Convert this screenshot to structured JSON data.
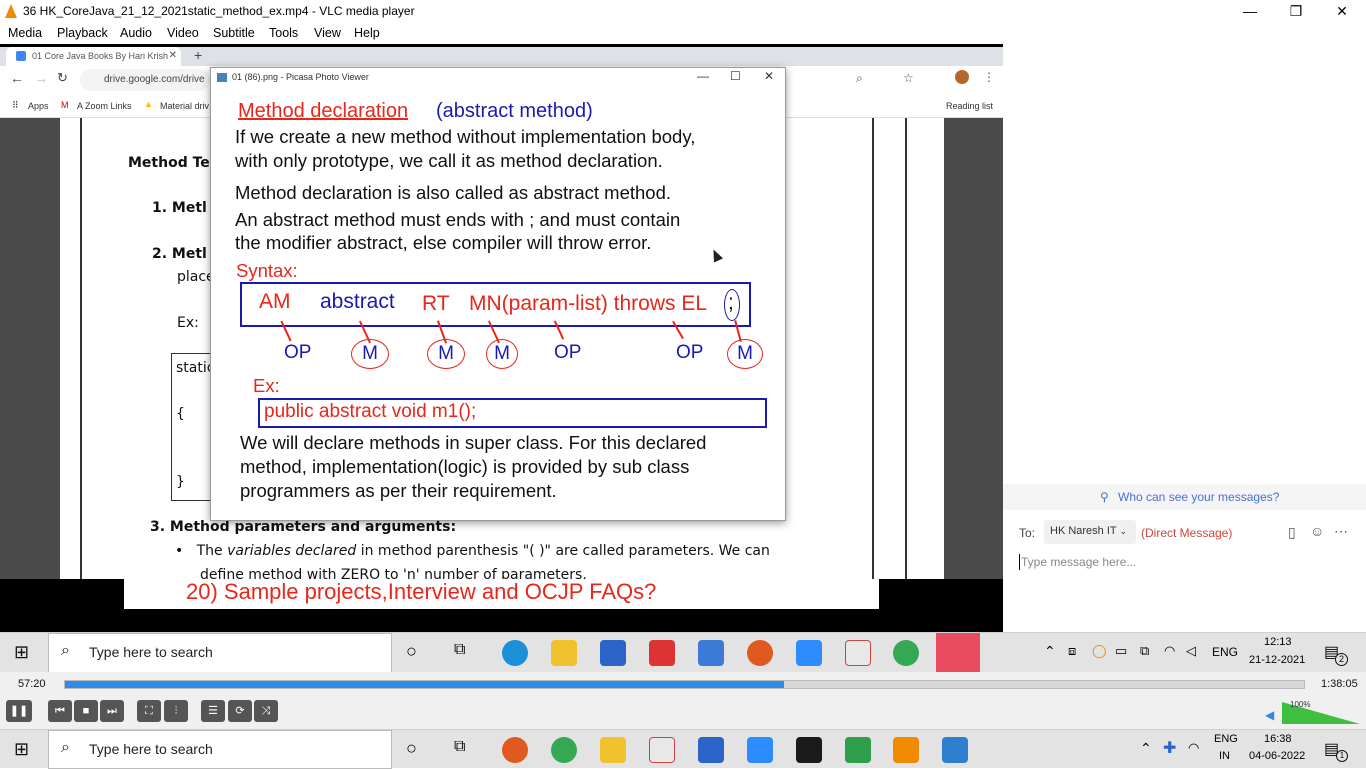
{
  "vlc": {
    "title": "36 HK_CoreJava_21_12_2021static_method_ex.mp4 - VLC media player",
    "menu": [
      "Media",
      "Playback",
      "Audio",
      "Video",
      "Subtitle",
      "Tools",
      "View",
      "Help"
    ],
    "time_elapsed": "57:20",
    "time_total": "1:38:05",
    "progress": 0.58,
    "volume": "100%"
  },
  "browser": {
    "tab_title": "01 Core Java Books By Hari Krish",
    "url": "drive.google.com/drive",
    "bookmarks": [
      "Apps",
      "A Zoom Links",
      "Material driv"
    ],
    "reading_list": "Reading list"
  },
  "doc": {
    "heading": "Method Ter",
    "item1": "1.  Metl",
    "item2": "2.  Metl",
    "item2_cont": "place",
    "ex": "Ex:",
    "code_head": "static",
    "brace_open": "{",
    "brace_close": "}",
    "item3": "3.   Method parameters and arguments:",
    "bullet_pre": "The ",
    "bullet_em": "variables declared",
    "bullet_post": " in method parenthesis \"( )\" are called parameters. We can",
    "bullet_line2": "define method with ZERO to 'n' number of parameters.",
    "banner": "20)  Sample projects,Interview and OCJP FAQs?"
  },
  "picasa": {
    "title": "01 (86).png - Picasa Photo Viewer",
    "heading": "Method declaration",
    "heading_sub": "(abstract method)",
    "para1_l1": "If we create a new method without implementation body,",
    "para1_l2": "with only prototype, we call it as method declaration.",
    "para2": "Method declaration is also called as abstract method.",
    "para3_l1": "An abstract method must ends with ; and must contain",
    "para3_l2": "the modifier abstract, else compiler will throw error.",
    "syntax_label": "Syntax:",
    "syntax": {
      "am": "AM",
      "abstract": "abstract",
      "rt": "RT",
      "mn": "MN(param-list) throws EL",
      "semi": ";"
    },
    "marks": [
      "OP",
      "M",
      "M",
      "M",
      "OP",
      "OP",
      "M"
    ],
    "ex_label": "Ex:",
    "example": "public  abstract  void  m1();",
    "para4_l1": "We will declare methods in super class. For this declared",
    "para4_l2": "method, implementation(logic) is provided by sub class",
    "para4_l3": "programmers as per their requirement."
  },
  "chat": {
    "who_can_see": "Who can see your messages?",
    "to_label": "To:",
    "recipient": "HK Naresh IT",
    "direct": "(Direct Message)",
    "placeholder": "Type message here..."
  },
  "taskbar_inner": {
    "search": "Type here to search",
    "lang": "ENG",
    "time": "12:13",
    "date": "21-12-2021",
    "notif": "2"
  },
  "taskbar_outer": {
    "search": "Type here to search",
    "lang": "ENG",
    "region": "IN",
    "time": "16:38",
    "date": "04-06-2022",
    "notif": "1"
  },
  "colors": {
    "accent_red": "#e8261a",
    "accent_blue": "#1a1ab0",
    "vlc_progress": "#2f8ae6"
  }
}
